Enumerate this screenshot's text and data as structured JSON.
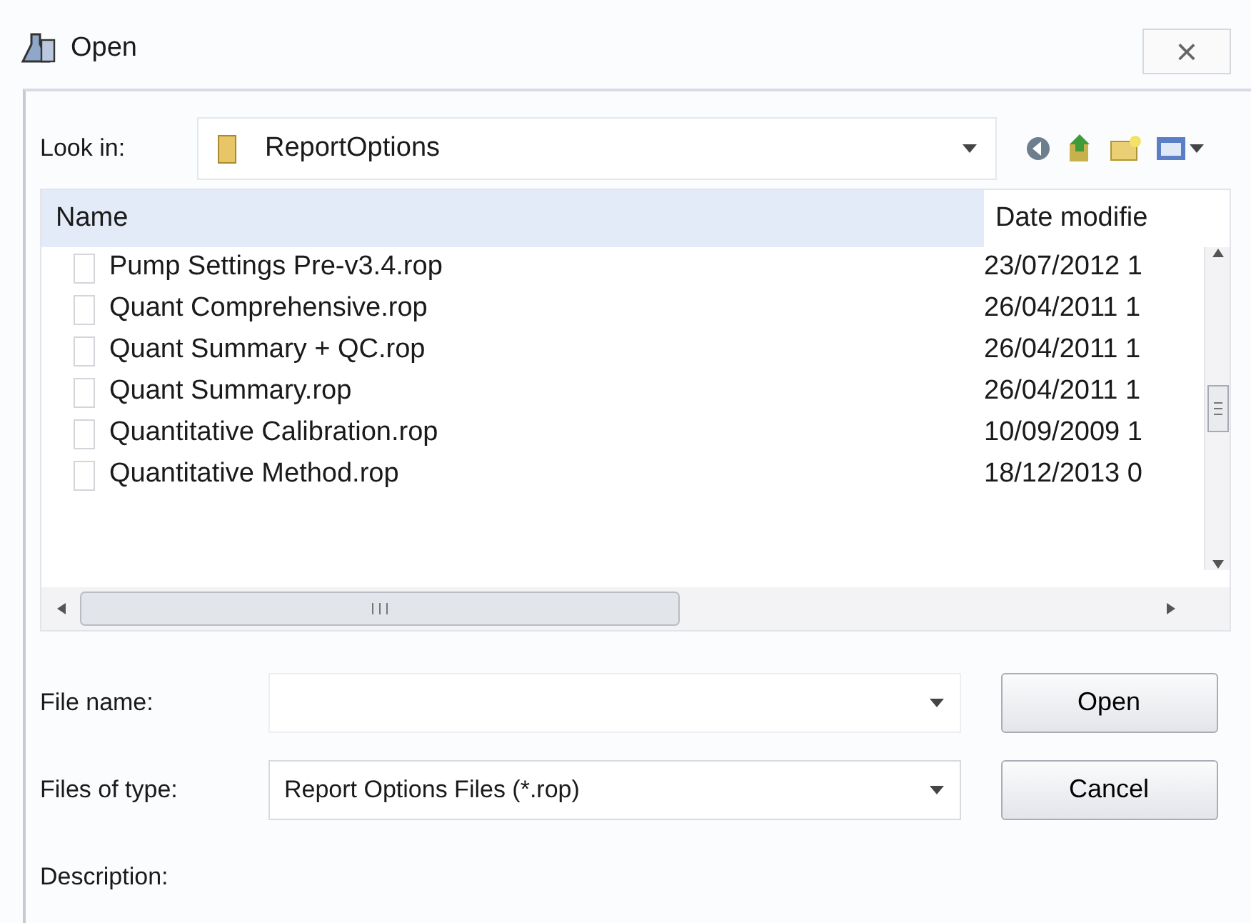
{
  "window": {
    "title": "Open",
    "close": "×"
  },
  "look_in": {
    "label": "Look in:",
    "folder": "ReportOptions"
  },
  "columns": [
    "Name",
    "Date modifie"
  ],
  "files": [
    {
      "name": "Pump Settings Pre-v3.4.rop",
      "date": "23/07/2012 1"
    },
    {
      "name": "Quant Comprehensive.rop",
      "date": "26/04/2011 1"
    },
    {
      "name": "Quant Summary + QC.rop",
      "date": "26/04/2011 1"
    },
    {
      "name": "Quant Summary.rop",
      "date": "26/04/2011 1"
    },
    {
      "name": "Quantitative Calibration.rop",
      "date": "10/09/2009 1"
    },
    {
      "name": "Quantitative Method.rop",
      "date": "18/12/2013 0"
    }
  ],
  "file_name": {
    "label": "File name:"
  },
  "file_type": {
    "label": "Files of type:",
    "value": "Report Options Files (*.rop)"
  },
  "description": {
    "label": "Description:"
  },
  "buttons": [
    "Open",
    "Cancel"
  ]
}
